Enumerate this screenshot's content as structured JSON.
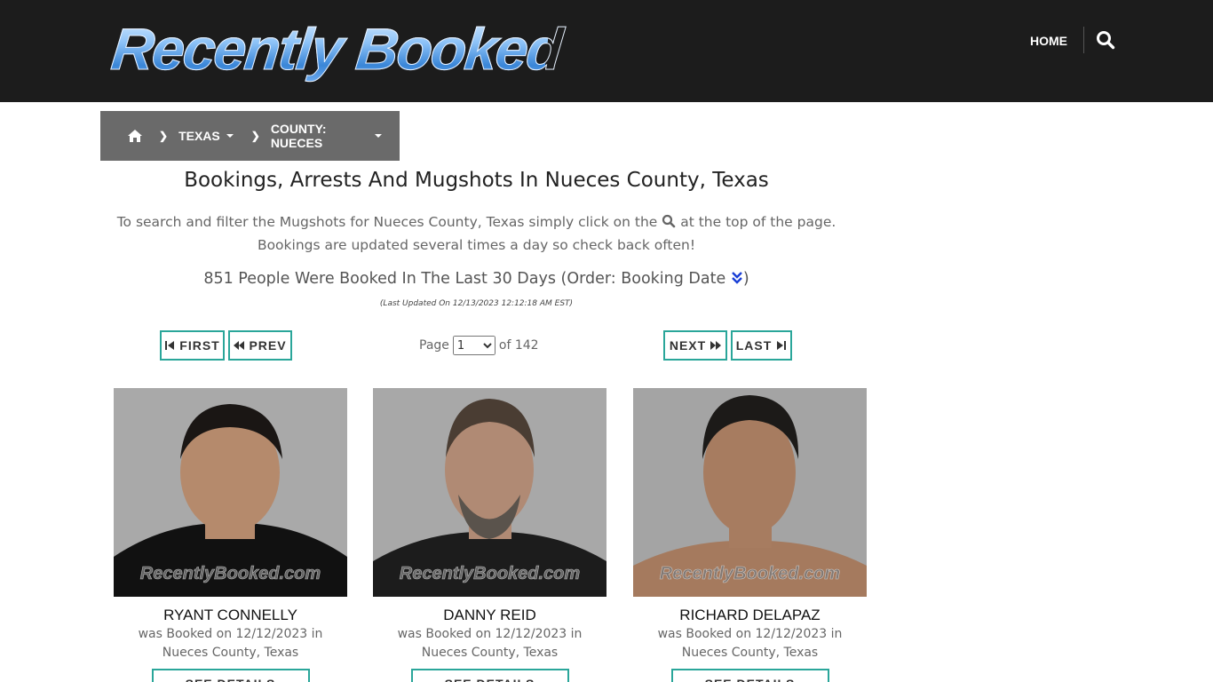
{
  "header": {
    "logo_text": "Recently Booked",
    "nav_home": "HOME",
    "search_icon": "search-icon"
  },
  "breadcrumb": {
    "home_icon": "home-icon",
    "items": [
      "TEXAS",
      "COUNTY: NUECES"
    ]
  },
  "main": {
    "title": "Bookings, Arrests And Mugshots In Nueces County, Texas",
    "intro_before": "To search and filter the Mugshots for Nueces County, Texas simply click on the",
    "intro_after": "at the top of the page. Bookings are updated several times a day so check back often!",
    "count_text": "851 People Were Booked In The Last 30 Days (Order: Booking Date",
    "count_close": ")",
    "last_updated": "(Last Updated On 12/13/2023 12:12:18 AM EST)"
  },
  "pagination": {
    "first": "FIRST",
    "prev": "PREV",
    "next": "NEXT",
    "last": "LAST",
    "page_label": "Page",
    "page_value": "1",
    "of_label": "of 142"
  },
  "cards": [
    {
      "name": "RYANT CONNELLY",
      "booked": "was Booked on 12/12/2023 in",
      "location": "Nueces County, Texas",
      "button": "SEE DETAILS",
      "watermark": "RecentlyBooked.com",
      "bg": "#a9a9a9",
      "shirt": "#111111",
      "skin": "#b58a6c",
      "hair": "#1a1614"
    },
    {
      "name": "DANNY REID",
      "booked": "was Booked on 12/12/2023 in",
      "location": "Nueces County, Texas",
      "button": "SEE DETAILS",
      "watermark": "RecentlyBooked.com",
      "bg": "#a8a8a8",
      "shirt": "#1c1c1c",
      "skin": "#b08a74",
      "hair": "#4a3d33"
    },
    {
      "name": "RICHARD DELAPAZ",
      "booked": "was Booked on 12/12/2023 in",
      "location": "Nueces County, Texas",
      "button": "SEE DETAILS",
      "watermark": "RecentlyBooked.com",
      "bg": "#a4a4a4",
      "shirt": "#a57a5e",
      "skin": "#a77c60",
      "hair": "#1c1a18"
    }
  ]
}
